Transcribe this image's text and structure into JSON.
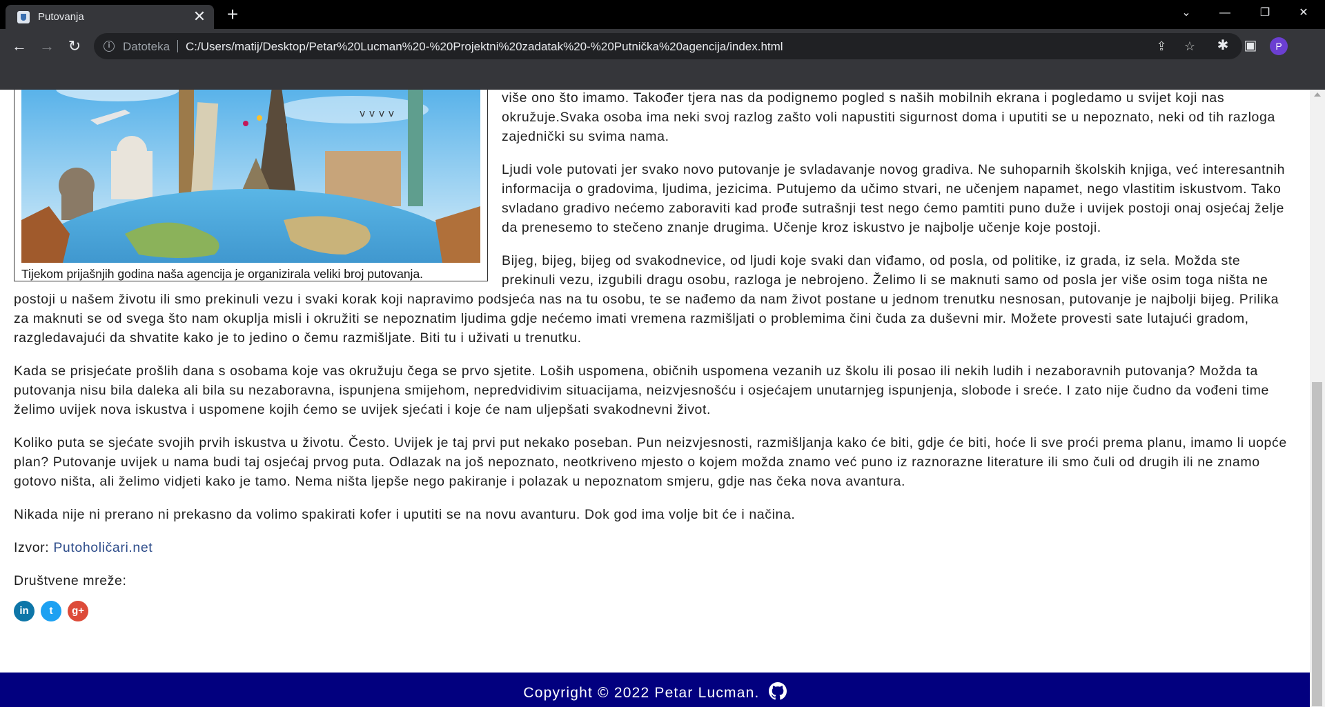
{
  "browser": {
    "tab_title": "Putovanja",
    "tab_close": "✕",
    "new_tab": "+",
    "window_controls": {
      "dropdown": "⌄",
      "minimize": "—",
      "restore": "❐",
      "close": "✕"
    },
    "address_scheme": "Datoteka",
    "address_url": "C:/Users/matij/Desktop/Petar%20Lucman%20-%20Projektni%20zadatak%20-%20Putnička%20agencija/index.html",
    "profile_initial": "P"
  },
  "figure": {
    "caption": "Tijekom prijašnjih godina naša agencija je organizirala veliki broj putovanja."
  },
  "article": {
    "paragraph_1": "više ono što imamo. Također tjera nas da podignemo pogled s naših mobilnih ekrana i pogledamo u svijet koji nas okružuje.Svaka osoba ima neki svoj razlog zašto voli napustiti sigurnost doma i uputiti se u nepoznato, neki od tih razloga zajednički su svima nama.",
    "paragraph_2": "Ljudi vole putovati jer svako novo putovanje je svladavanje novog gradiva. Ne suhoparnih školskih knjiga, već interesantnih informacija o gradovima, ljudima, jezicima. Putujemo da učimo stvari, ne učenjem napamet, nego vlastitim iskustvom. Tako svladano gradivo nećemo zaboraviti kad prođe sutrašnji test nego ćemo pamtiti puno duže i uvijek postoji onaj osjećaj želje da prenesemo to stečeno znanje drugima. Učenje kroz iskustvo je najbolje učenje koje postoji.",
    "paragraph_3": "Bijeg, bijeg, bijeg od svakodnevice, od ljudi koje svaki dan viđamo, od posla, od politike, iz grada, iz sela. Možda ste prekinuli vezu, izgubili dragu osobu, razloga je nebrojeno. Želimo li se maknuti samo od posla jer više osim toga ništa ne postoji u našem životu ili smo prekinuli vezu i svaki korak koji napravimo podsjeća nas na tu osobu, te se nađemo da nam život postane u jednom trenutku nesnosan, putovanje je najbolji bijeg. Prilika za maknuti se od svega što nam okuplja misli i okružiti se nepoznatim ljudima gdje nećemo imati vremena razmišljati o problemima čini čuda za duševni mir. Možete provesti sate lutajući gradom, razgledavajući da shvatite kako je to jedino o čemu razmišljate. Biti tu i uživati u trenutku.",
    "paragraph_4": "Kada se prisjećate prošlih dana s osobama koje vas okružuju čega se prvo sjetite. Loših uspomena, običnih uspomena vezanih uz školu ili posao ili nekih ludih i nezaboravnih putovanja? Možda ta putovanja nisu bila daleka ali bila su nezaboravna, ispunjena smijehom, nepredvidivim situacijama, neizvjesnošću i osjećajem unutarnjeg ispunjenja, slobode i sreće. I zato nije čudno da vođeni time želimo uvijek nova iskustva i uspomene kojih ćemo se uvijek sjećati i koje će nam uljepšati svakodnevni život.",
    "paragraph_5": "Koliko puta se sjećate svojih prvih iskustva u životu. Često. Uvijek je taj prvi put nekako poseban. Pun neizvjesnosti, razmišljanja kako će biti, gdje će biti, hoće li sve proći prema planu, imamo li uopće plan? Putovanje uvijek u nama budi taj osjećaj prvog puta. Odlazak na još nepoznato, neotkriveno mjesto o kojem možda znamo već puno iz raznorazne literature ili smo čuli od drugih ili ne znamo gotovo ništa, ali želimo vidjeti kako je tamo. Nema ništa ljepše nego pakiranje i polazak u nepoznatom smjeru, gdje nas čeka nova avantura.",
    "paragraph_6": "Nikada nije ni prerano ni prekasno da volimo spakirati kofer i uputiti se na novu avanturu. Dok god ima volje bit će i načina.",
    "source_label": "Izvor:",
    "source_link": "Putoholičari.net",
    "social_label": "Društvene mreže:"
  },
  "socials": [
    {
      "name": "linkedin",
      "glyph": "in",
      "color": "#0e76a8"
    },
    {
      "name": "twitter",
      "glyph": "t",
      "color": "#1da1f2"
    },
    {
      "name": "google-plus",
      "glyph": "g+",
      "color": "#dd4b39"
    }
  ],
  "footer": {
    "copyright": "Copyright © 2022 Petar Lucman."
  },
  "colors": {
    "footer_bg": "#02007f",
    "link": "#2d4c8a"
  }
}
